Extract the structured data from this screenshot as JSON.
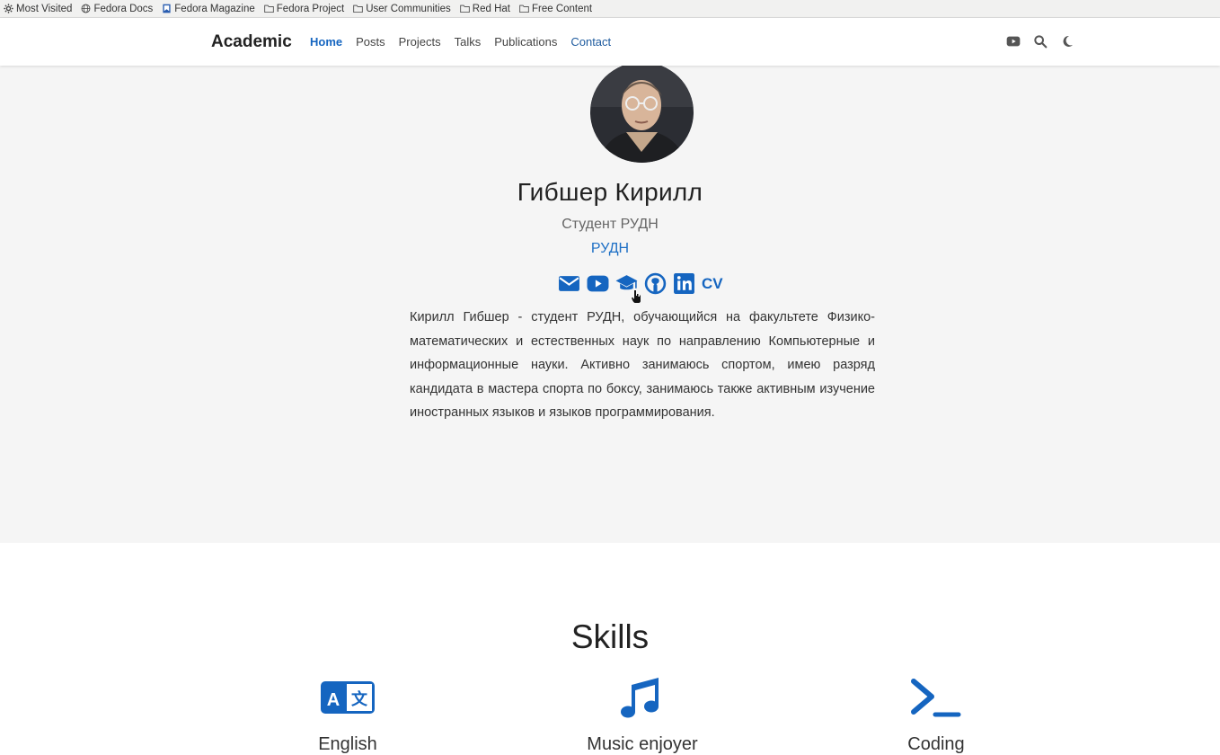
{
  "bookmarks": [
    {
      "label": "Most Visited",
      "icon": "gear-icon"
    },
    {
      "label": "Fedora Docs",
      "icon": "globe-icon"
    },
    {
      "label": "Fedora Magazine",
      "icon": "magazine-icon"
    },
    {
      "label": "Fedora Project",
      "icon": "folder-icon"
    },
    {
      "label": "User Communities",
      "icon": "folder-icon"
    },
    {
      "label": "Red Hat",
      "icon": "folder-icon"
    },
    {
      "label": "Free Content",
      "icon": "folder-icon"
    }
  ],
  "navbar": {
    "brand": "Academic",
    "items": [
      "Home",
      "Posts",
      "Projects",
      "Talks",
      "Publications",
      "Contact"
    ],
    "active": "Home",
    "icons": [
      "youtube-icon",
      "search-icon",
      "moon-icon"
    ]
  },
  "profile": {
    "name": "Гибшер Кирилл",
    "role": "Студент РУДН",
    "organization": "РУДН",
    "social_icons": [
      "envelope-icon",
      "youtube-icon",
      "graduation-cap-icon",
      "github-icon",
      "linkedin-icon",
      "cv-icon"
    ],
    "cv_label": "CV",
    "bio": "Кирилл Гибшер - студент РУДН, обучающийся на факультете Физико-математических и естественных наук по направлению Компьютерные и информационные науки. Активно занимаюсь спортом, имею разряд кандидата в мастера спорта по боксу, занимаюсь также активным изучение иностранных языков и языков программирования."
  },
  "skills": {
    "title": "Skills",
    "items": [
      {
        "label": "English",
        "icon": "language-icon"
      },
      {
        "label": "Music enjoyer",
        "icon": "music-icon"
      },
      {
        "label": "Coding",
        "icon": "terminal-icon"
      }
    ]
  },
  "colors": {
    "accent": "#1565c0",
    "hero_bg": "#f5f5f5"
  }
}
